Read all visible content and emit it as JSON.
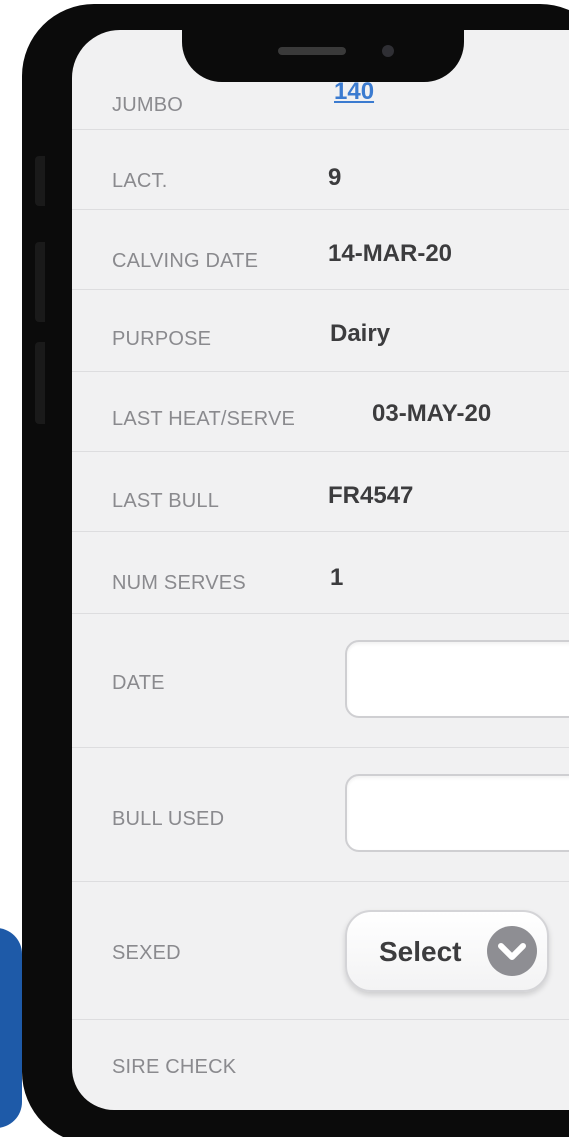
{
  "rows": {
    "jumbo": {
      "label": "JUMBO",
      "value": "140"
    },
    "lact": {
      "label": "LACT.",
      "value": "9"
    },
    "calving_date": {
      "label": "CALVING DATE",
      "value": "14-MAR-20"
    },
    "purpose": {
      "label": "PURPOSE",
      "value": "Dairy"
    },
    "last_heat_serve": {
      "label": "LAST HEAT/SERVE",
      "value": "03-MAY-20"
    },
    "last_bull": {
      "label": "LAST BULL",
      "value": "FR4547"
    },
    "num_serves": {
      "label": "NUM SERVES",
      "value": "1"
    },
    "date": {
      "label": "DATE",
      "value": "",
      "placeholder": ""
    },
    "bull_used": {
      "label": "BULL USED",
      "value": "",
      "placeholder": ""
    },
    "sexed": {
      "label": "SEXED",
      "select_label": "Select"
    },
    "sire_check": {
      "label": "SIRE CHECK"
    }
  },
  "colors": {
    "link": "#3b7bd0",
    "label": "#8a8a8e",
    "value": "#3c3c3e",
    "screen_bg": "#f1f1f2",
    "accent_blue": "#1e5aa8"
  },
  "icons": {
    "select_chevron": "chevron-down-icon"
  }
}
